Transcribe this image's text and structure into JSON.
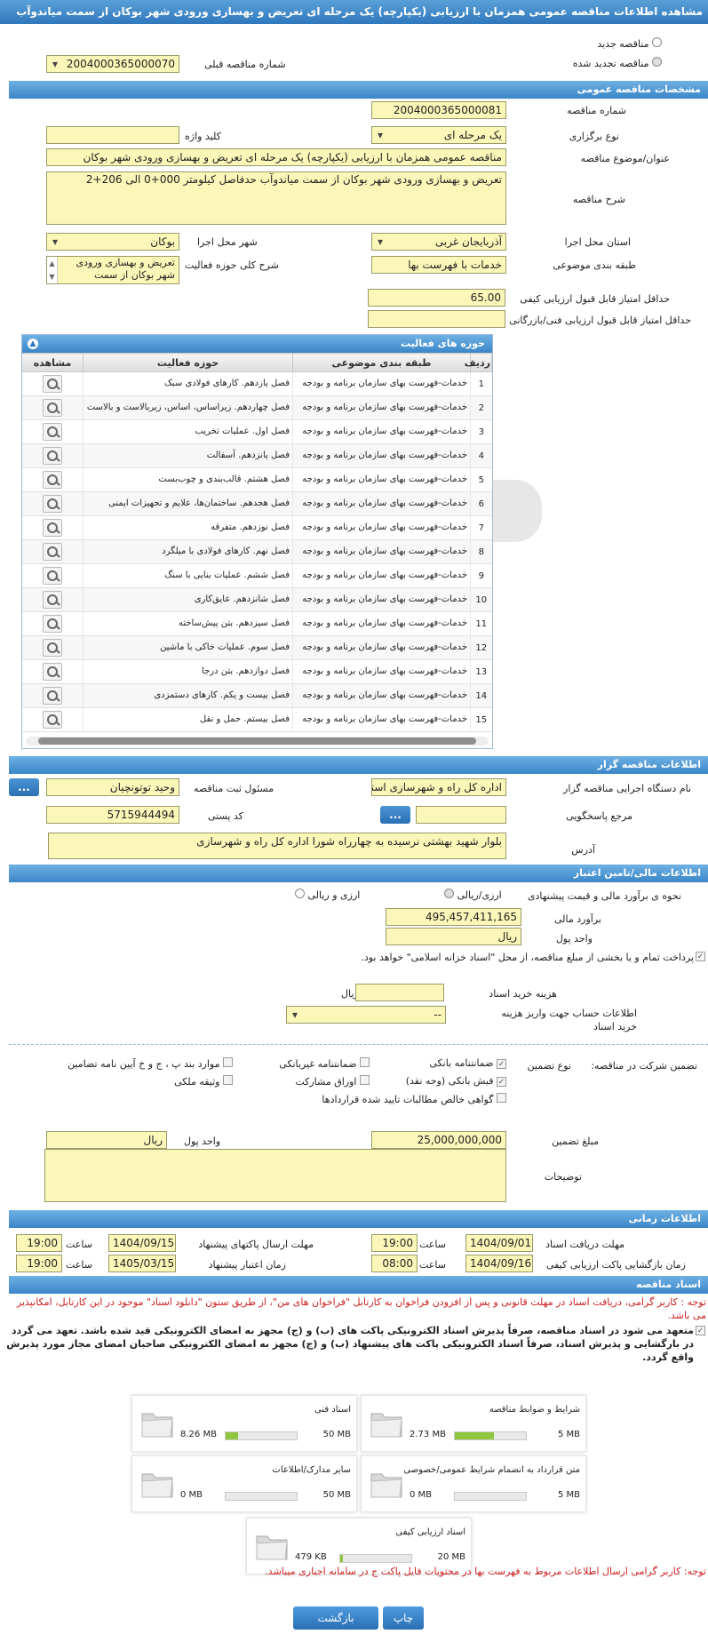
{
  "header": {
    "title": "مشاهده اطلاعات مناقصه عمومی همزمان با ارزیابی (یکپارچه) یک مرحله ای تعریض و بهسازی ورودی شهر بوکان از سمت میاندوآب"
  },
  "tender_type": {
    "new_label": "مناقصه جدید",
    "renewed_label": "مناقصه تجدید شده",
    "selected": "renewed"
  },
  "previous": {
    "label": "شماره مناقصه قبلی",
    "value": "2004000365000070"
  },
  "general": {
    "section": "مشخصات مناقصه عمومی",
    "number_label": "شماره مناقصه",
    "number": "2004000365000081",
    "hold_type_label": "نوع برگزاری",
    "hold_type": "یک مرحله ای",
    "keyword_label": "کلید واژه",
    "keyword": "",
    "subject_label": "عنوان/موضوع مناقصه",
    "subject": "مناقصه عمومی همزمان با ارزیابی (یکپارچه) یک مرحله ای تعریض و بهسازی ورودی شهر بوکان",
    "desc_label": "شرح مناقصه",
    "desc": "تعریض و بهسازی ورودی شهر بوکان از سمت میاندوآب حدفاصل کیلومتر 000+0 الی 206+2",
    "province_label": "استان محل اجرا",
    "province": "آذربایجان غربی",
    "city_label": "شهر محل اجرا",
    "city": "بوکان",
    "category_label": "طبقه بندی موضوعی",
    "category": "خدمات با فهرست بها",
    "activity_desc_label": "شرح کلی حوزه فعالیت",
    "activity_desc": "تعریض و بهسازی ورودی شهر بوکان از سمت",
    "min_quality_label": "حداقل امتیاز قابل قبول ارزیابی کیفی",
    "min_quality": "65.00",
    "min_tech_label": "حداقل امتیاز قابل قبول ارزیابی فنی/بازرگانی",
    "min_tech": ""
  },
  "activities": {
    "title": "حوزه های فعالیت",
    "headers": [
      "ردیف",
      "طبقه بندی موضوعی",
      "حوزه فعالیت",
      "مشاهده"
    ],
    "rows": [
      {
        "no": "1",
        "category": "خدمات-فهرست بهای سازمان برنامه و بودجه",
        "field": "فصل یازدهم. کارهای فولادی سبک"
      },
      {
        "no": "2",
        "category": "خدمات-فهرست بهای سازمان برنامه و بودجه",
        "field": "فصل چهاردهم. زیراساس، اساس، زیربالاست و بالاست"
      },
      {
        "no": "3",
        "category": "خدمات-فهرست بهای سازمان برنامه و بودجه",
        "field": "فصل اول. عملیات تخریب"
      },
      {
        "no": "4",
        "category": "خدمات-فهرست بهای سازمان برنامه و بودجه",
        "field": "فصل پانزدهم. آسفالت"
      },
      {
        "no": "5",
        "category": "خدمات-فهرست بهای سازمان برنامه و بودجه",
        "field": "فصل هشتم. قالب‌بندی و چوب‌بست"
      },
      {
        "no": "6",
        "category": "خدمات-فهرست بهای سازمان برنامه و بودجه",
        "field": "فصل هجدهم. ساختمان‌ها، علایم و تجهیزات ایمنی"
      },
      {
        "no": "7",
        "category": "خدمات-فهرست بهای سازمان برنامه و بودجه",
        "field": "فصل نوزدهم. متفرقه"
      },
      {
        "no": "8",
        "category": "خدمات-فهرست بهای سازمان برنامه و بودجه",
        "field": "فصل نهم. کارهای فولادی با میلگرد"
      },
      {
        "no": "9",
        "category": "خدمات-فهرست بهای سازمان برنامه و بودجه",
        "field": "فصل ششم. عملیات بنایی با سنگ"
      },
      {
        "no": "10",
        "category": "خدمات-فهرست بهای سازمان برنامه و بودجه",
        "field": "فصل شانزدهم. عایق‌کاری"
      },
      {
        "no": "11",
        "category": "خدمات-فهرست بهای سازمان برنامه و بودجه",
        "field": "فصل سیزدهم. بتن پیش‌ساخته"
      },
      {
        "no": "12",
        "category": "خدمات-فهرست بهای سازمان برنامه و بودجه",
        "field": "فصل سوم. عملیات خاکی با ماشین"
      },
      {
        "no": "13",
        "category": "خدمات-فهرست بهای سازمان برنامه و بودجه",
        "field": "فصل دوازدهم. بتن درجا"
      },
      {
        "no": "14",
        "category": "خدمات-فهرست بهای سازمان برنامه و بودجه",
        "field": "فصل بیست و یکم. کارهای دستمزدی"
      },
      {
        "no": "15",
        "category": "خدمات-فهرست بهای سازمان برنامه و بودجه",
        "field": "فصل بیستم. حمل و نقل"
      }
    ]
  },
  "organizer": {
    "section": "اطلاعات مناقصه گزار",
    "org_label": "نام دستگاه اجرایی مناقصه گزار",
    "org": "اداره کل راه و شهرسازی استان",
    "registrar_label": "مسئول ثبت مناقصه",
    "registrar": "وحید توتونچیان",
    "ref_label": "مرجع پاسخگویی",
    "ref": "",
    "postal_label": "کد پستی",
    "postal": "5715944494",
    "address_label": "آدرس",
    "address": "بلوار شهید بهشتی نرسیده به چهارراه شورا اداره کل راه و شهرسازی",
    "dots": "..."
  },
  "finance": {
    "section": "اطلاعات مالی/تامین اعتبار",
    "method_label": "نحوه ی برآورد مالی و قیمت پیشنهادی",
    "opt_rial": "ارزی/ریالی",
    "opt_fx": "ارزی و ریالی",
    "estimate_label": "برآورد مالی",
    "estimate": "495,457,411,165",
    "currency_label": "واحد پول",
    "currency": "ریال",
    "treasury_text": "پرداخت تمام و یا بخشی از مبلغ مناقصه، از محل \"اسناد خزانه اسلامی\" خواهد بود.",
    "doc_cost_label": "هزینه خرید اسناد",
    "doc_cost": "",
    "doc_cost_unit": "ریال",
    "account_label": "اطلاعات حساب جهت واریز هزینه خرید اسناد",
    "account": "--"
  },
  "guarantee": {
    "participation_label": "تضمین شرکت در مناقصه:",
    "type_label": "نوع تضمین",
    "bank": "ضمانتنامه بانکی",
    "nonbank": "ضمانتنامه غیربانکی",
    "items": "موارد بند پ ، ج و خ آیین نامه تضامین",
    "receipt": "فیش بانکی (وجه نقد)",
    "bonds": "اوراق مشارکت",
    "property": "وثیقه ملکی",
    "claims": "گواهی خالص مطالبات تایید شده قراردادها",
    "amount_label": "مبلغ تضمین",
    "amount": "25,000,000,000",
    "unit_label": "واحد پول",
    "unit": "ریال",
    "notes_label": "توضیحات",
    "notes": ""
  },
  "timing": {
    "section": "اطلاعات زمانی",
    "receive_label": "مهلت دریافت اسناد",
    "receive_date": "1404/09/01",
    "receive_time": "19:00",
    "send_label": "مهلت ارسال پاکتهای پیشنهاد",
    "send_date": "1404/09/15",
    "send_time": "19:00",
    "open_label": "زمان بازگشایی پاکت ارزیابی کیفی",
    "open_date": "1404/09/16",
    "open_time": "08:00",
    "valid_label": "زمان اعتبار پیشنهاد",
    "valid_date": "1405/03/15",
    "valid_time": "19:00",
    "time_label": "ساعت"
  },
  "documents": {
    "section": "اسناد مناقصه",
    "note1": "توجه : کاربر گرامی، دریافت اسناد در مهلت قانونی و پس از افزودن فراخوان به کارتابل \"فراخوان های من\"، از طریق ستون \"دانلود اسناد\" موجود در این کارتابل، امکانپذیر می باشد.",
    "pledge": "متعهد می شود در اسناد مناقصه، صرفاً پذیرش اسناد الکترونیکی پاکت های (ب) و (ج) مجهز به امضای الکترونیکی قید شده باشد. تعهد می گردد در بارگشایی و پذیرش اسناد، صرفاً اسناد الکترونیکی پاکت های پیشنهاد (ب) و (ج) مجهز به امضای الکترونیکی صاحبان امضای مجاز مورد پذیرش واقع گردد.",
    "cards": [
      {
        "title": "شرایط و ضوابط مناقصه",
        "used": "2.73 MB",
        "max": "5 MB",
        "fill": 0.55
      },
      {
        "title": "اسناد فنی",
        "used": "8.26 MB",
        "max": "50 MB",
        "fill": 0.17
      },
      {
        "title": "متن قرارداد به انضمام شرایط عمومی/خصوصی",
        "used": "0 MB",
        "max": "5 MB",
        "fill": 0.0
      },
      {
        "title": "سایر مدارک/اطلاعات",
        "used": "0 MB",
        "max": "50 MB",
        "fill": 0.0
      },
      {
        "title": "اسناد ارزیابی کیفی",
        "used": "479 KB",
        "max": "20 MB",
        "fill": 0.03
      }
    ],
    "note2": "توجه: کاربر گرامی ارسال اطلاعات مربوط به فهرست بها در محتویات فایل پاکت ج در سامانه اجباری میباشد."
  },
  "footer": {
    "print": "چاپ",
    "back": "بازگشت"
  }
}
